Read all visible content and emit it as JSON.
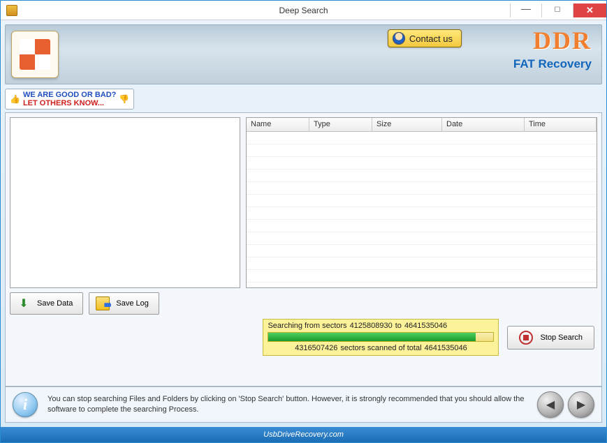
{
  "titlebar": {
    "title": "Deep Search"
  },
  "banner": {
    "contact_label": "Contact us",
    "brand": "DDR",
    "brand_sub": "FAT Recovery"
  },
  "feedback": {
    "line1": "WE ARE GOOD OR BAD?",
    "line2": "LET OTHERS KNOW..."
  },
  "columns": {
    "name": "Name",
    "type": "Type",
    "size": "Size",
    "date": "Date",
    "time": "Time"
  },
  "buttons": {
    "save_data": "Save Data",
    "save_log": "Save Log",
    "stop_search": "Stop Search"
  },
  "progress": {
    "prefix": "Searching from sectors",
    "from": "4125808930",
    "to_word": "to",
    "to": "4641535046",
    "scanned": "4316507426",
    "mid": "sectors scanned of total",
    "total": "4641535046",
    "percent": 92
  },
  "hint": "You can stop searching Files and Folders by clicking on 'Stop Search' button. However, it is strongly recommended that you should allow the software to complete the searching Process.",
  "footer": "UsbDriveRecovery.com"
}
